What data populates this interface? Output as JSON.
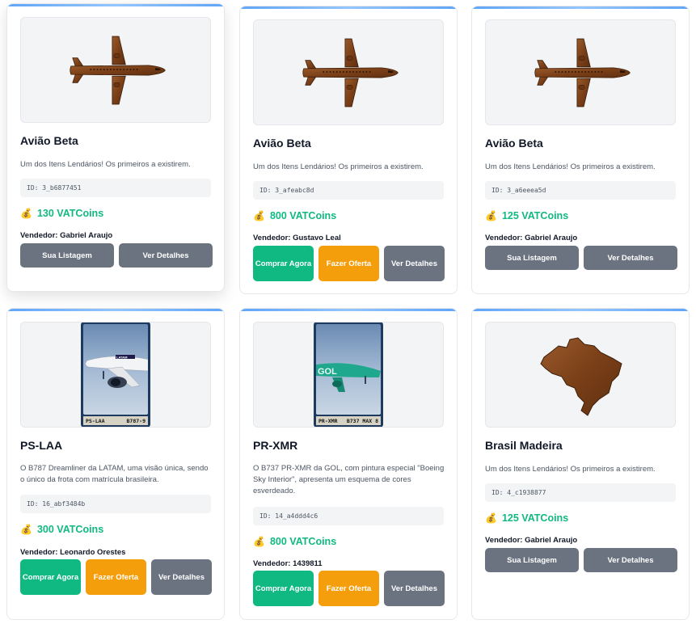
{
  "colors": {
    "accent_green": "#10b981",
    "accent_orange": "#f59e0b",
    "gray": "#6b7280",
    "top_border": "#60a5fa"
  },
  "cards": [
    {
      "title": "Avião Beta",
      "image": "wooden-plane-icon",
      "description": "Um dos Itens Lendários! Os primeiros a existirem.",
      "id": "ID: 3_b6877451",
      "price": "130 VATCoins",
      "seller": "Vendedor: Gabriel Araujo",
      "buttons": [
        "Sua Listagem",
        "Ver Detalhes"
      ]
    },
    {
      "title": "Avião Beta",
      "image": "wooden-plane-icon",
      "description": "Um dos Itens Lendários! Os primeiros a existirem.",
      "id": "ID: 3_afeabc8d",
      "price": "800 VATCoins",
      "seller": "Vendedor: Gustavo Leal",
      "buttons": [
        "Comprar Agora",
        "Fazer Oferta",
        "Ver Detalhes"
      ]
    },
    {
      "title": "Avião Beta",
      "image": "wooden-plane-icon",
      "description": "Um dos Itens Lendários! Os primeiros a existirem.",
      "id": "ID: 3_a6eeea5d",
      "price": "125 VATCoins",
      "seller": "Vendedor: Gabriel Araujo",
      "buttons": [
        "Sua Listagem",
        "Ver Detalhes"
      ]
    },
    {
      "title": "PS-LAA",
      "image": "latam-b787-photo",
      "plate_left": "PS-LAA",
      "plate_right": "B787-9",
      "description": "O B787 Dreamliner da LATAM, uma visão única, sendo o único da frota com matrícula brasileira.",
      "id": "ID: 16_abf3484b",
      "price": "300 VATCoins",
      "seller": "Vendedor: Leonardo Orestes",
      "buttons": [
        "Comprar Agora",
        "Fazer Oferta",
        "Ver Detalhes"
      ]
    },
    {
      "title": "PR-XMR",
      "image": "gol-b737-photo",
      "plate_left": "PR-XMR",
      "plate_right": "B737 MAX 8",
      "description": "O B737 PR-XMR da GOL, com pintura especial \"Boeing Sky Interior\", apresenta um esquema de cores esverdeado.",
      "id": "ID: 14_a4ddd4c6",
      "price": "800 VATCoins",
      "seller": "Vendedor: 1439811",
      "buttons": [
        "Comprar Agora",
        "Fazer Oferta",
        "Ver Detalhes"
      ]
    },
    {
      "title": "Brasil Madeira",
      "image": "wooden-brazil-map",
      "description": "Um dos Itens Lendários! Os primeiros a existirem.",
      "id": "ID: 4_c1938877",
      "price": "125 VATCoins",
      "seller": "Vendedor: Gabriel Araujo",
      "buttons": [
        "Sua Listagem",
        "Ver Detalhes"
      ]
    }
  ]
}
